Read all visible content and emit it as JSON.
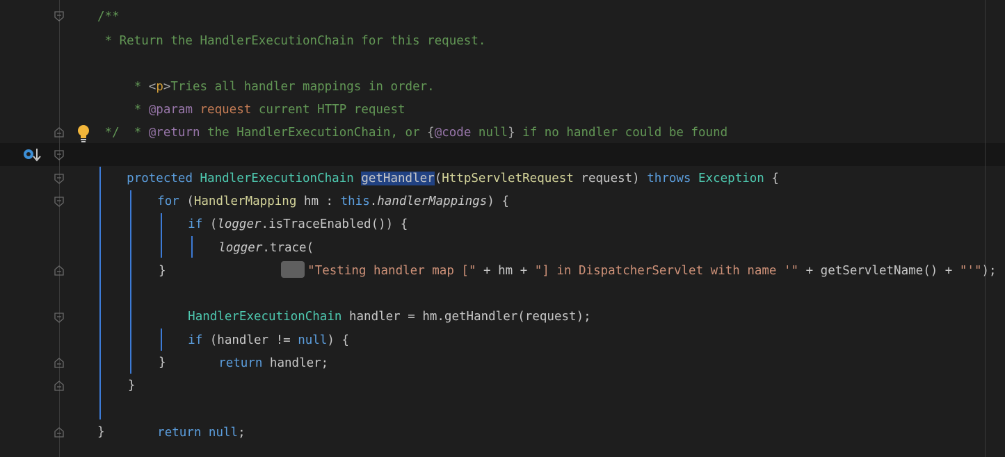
{
  "code": {
    "l1": "/**",
    "l2": " * Return the HandlerExecutionChain for this request.",
    "l3a": " * ",
    "l3b": "<",
    "l3c": "p",
    "l3d": ">",
    "l3e": "Tries all handler mappings in order.",
    "l4a": " * ",
    "l4b": "@param",
    "l4c": " request",
    "l4d": " current HTTP request",
    "l5a": " * ",
    "l5b": "@return",
    "l5c": " the HandlerExecutionChain, or ",
    "l5d": "{",
    "l5e": "@code",
    "l5f": " null",
    "l5g": "}",
    "l5h": " if no handler could be found",
    "l6": " */",
    "l7_protected": "protected ",
    "l7_type": "HandlerExecutionChain",
    "l7_space": " ",
    "l7_method": "getHandler",
    "l7_paren": "(",
    "l7_ptype": "HttpServletRequest",
    "l7_pname": " request) ",
    "l7_throws": "throws ",
    "l7_exc": "Exception",
    "l7_end": " {",
    "l8_for": "for ",
    "l8_p": "(",
    "l8_type": "HandlerMapping",
    "l8_hm": " hm : ",
    "l8_this": "this",
    "l8_dot": ".",
    "l8_field": "handlerMappings",
    "l8_end": ") {",
    "l9_if": "if ",
    "l9_p": "(",
    "l9_logger": "logger",
    "l9_rest": ".isTraceEnabled()) {",
    "l10_logger": "logger",
    "l10_rest": ".trace(",
    "l11_str1": "\"Testing handler map [\"",
    "l11_mid1": " + hm + ",
    "l11_str2": "\"] in DispatcherServlet with name '\"",
    "l11_mid2": " + getServletName() + ",
    "l11_str3": "\"'\"",
    "l11_end": ");",
    "l12": "}",
    "l13_type": "HandlerExecutionChain",
    "l13_rest": " handler = hm.getHandler(request);",
    "l14_if": "if ",
    "l14_mid": "(handler != ",
    "l14_null": "null",
    "l14_end": ") {",
    "l15_return": "return ",
    "l15_rest": "handler;",
    "l16": "}",
    "l17": "}",
    "l18_return": "return ",
    "l18_null": "null",
    "l18_end": ";",
    "l19": "}"
  },
  "icons": {
    "bulb": "lightbulb-icon",
    "override": "override-method-icon"
  },
  "colors": {
    "background": "#1e1e1e",
    "comment": "#629755",
    "keyword": "#5c9fdf",
    "type": "#4ec9b0",
    "string": "#ce9178",
    "selection": "#214283",
    "guide": "#3d7bd6"
  }
}
